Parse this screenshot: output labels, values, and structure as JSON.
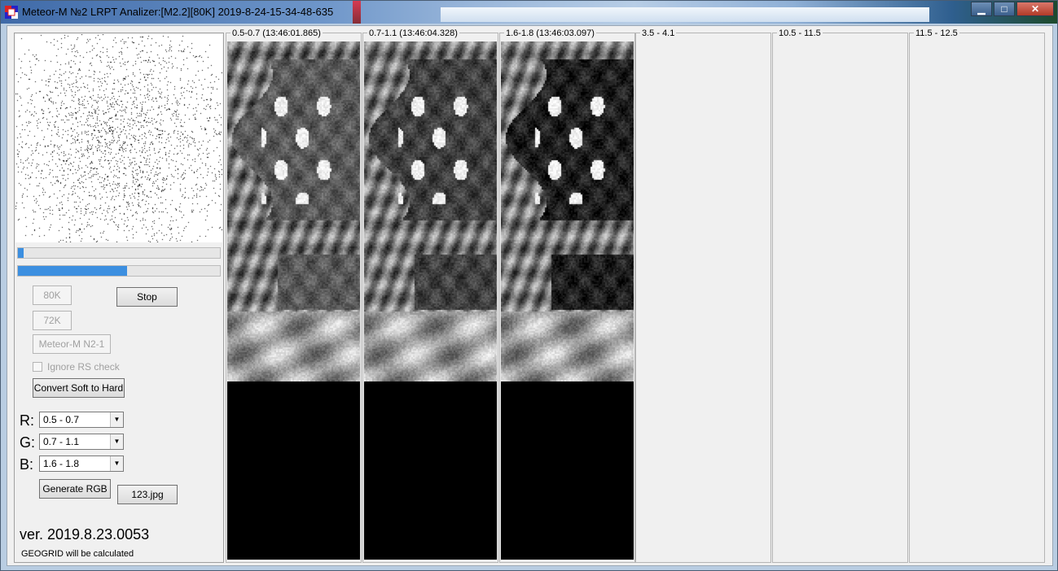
{
  "window": {
    "title": "Meteor-M №2 LRPT Analizer:[M2.2][80K] 2019-8-24-15-34-48-635",
    "minimize_glyph": "▁",
    "maximize_glyph": "□",
    "close_glyph": "✕"
  },
  "controls": {
    "btn_80k": "80K",
    "btn_stop": "Stop",
    "btn_72k": "72K",
    "btn_meteor": "Meteor-M N2-1",
    "chk_ignore_rs": "Ignore RS check",
    "btn_convert": "Convert Soft to Hard",
    "btn_generate": "Generate RGB",
    "btn_file": "123.jpg"
  },
  "progress": {
    "bar1_percent": 3,
    "bar2_percent": 54
  },
  "rgb": {
    "r_label": "R:",
    "g_label": "G:",
    "b_label": "B:",
    "r_value": "0.5 - 0.7",
    "g_value": "0.7 - 1.1",
    "b_value": "1.6 - 1.8"
  },
  "footer": {
    "version": "ver. 2019.8.23.0053",
    "geogrid": "GEOGRID will be calculated"
  },
  "channels": [
    {
      "caption": "0.5-0.7 (13:46:01.865)",
      "has_image": true
    },
    {
      "caption": "0.7-1.1 (13:46:04.328)",
      "has_image": true
    },
    {
      "caption": "1.6-1.8 (13:46:03.097)",
      "has_image": true
    },
    {
      "caption": "3.5 - 4.1",
      "has_image": false
    },
    {
      "caption": "10.5 - 11.5",
      "has_image": false
    },
    {
      "caption": "11.5 - 12.5",
      "has_image": false
    }
  ],
  "colors": {
    "progress_fill": "#3c8fe0",
    "panel_bg": "#f0f0f0"
  }
}
